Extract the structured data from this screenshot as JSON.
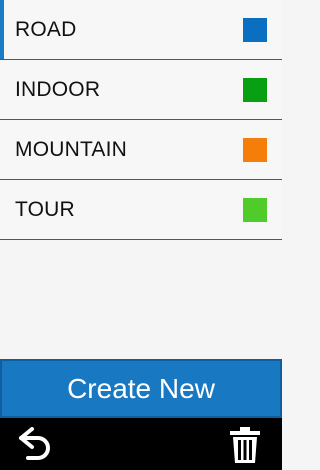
{
  "activities": [
    {
      "label": "ROAD",
      "color": "#0a6fc0",
      "selected": true
    },
    {
      "label": "INDOOR",
      "color": "#08a012",
      "selected": false
    },
    {
      "label": "MOUNTAIN",
      "color": "#f57e0a",
      "selected": false
    },
    {
      "label": "TOUR",
      "color": "#4fcc2c",
      "selected": false
    }
  ],
  "create_button": {
    "label": "Create New",
    "color": "#1978c2"
  },
  "toolbar": {
    "back_icon": "back-arrow-icon",
    "delete_icon": "trash-icon"
  }
}
